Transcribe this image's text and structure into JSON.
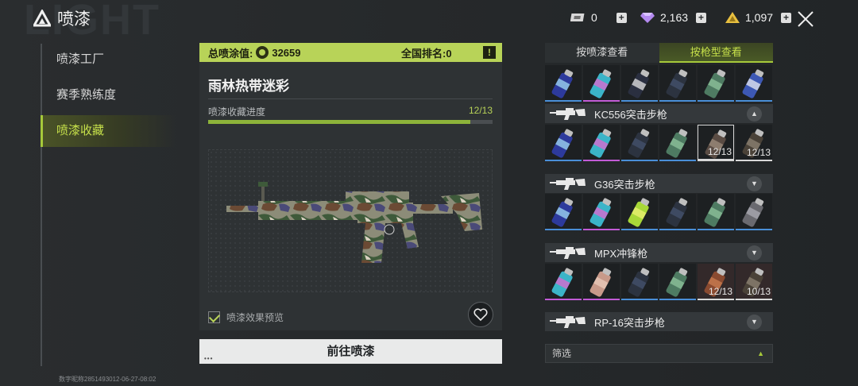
{
  "header": {
    "title": "喷漆",
    "watermark": "LIGHT",
    "currencies": [
      {
        "icon": "ticket-icon",
        "value": "0"
      },
      {
        "icon": "diamond-icon",
        "value": "2,163"
      },
      {
        "icon": "triangle-coin-icon",
        "value": "1,097"
      }
    ],
    "plus": "+"
  },
  "nav": {
    "items": [
      {
        "label": "喷漆工厂",
        "active": false
      },
      {
        "label": "赛季熟练度",
        "active": false
      },
      {
        "label": "喷漆收藏",
        "active": true
      }
    ]
  },
  "footer": {
    "id_text": "数字昵称2851493012-06-27-08:02"
  },
  "card": {
    "score_label": "总喷涂值:",
    "score_value": "32659",
    "rank_label": "全国排名:0",
    "info": "!",
    "skin_name": "雨林热带迷彩",
    "progress_label": "喷漆收藏进度",
    "progress_text": "12/13",
    "progress_fraction": 0.923,
    "preview_label": "喷漆效果预览",
    "goto_label": "前往喷漆",
    "goto_dots": "•••"
  },
  "right": {
    "tabs": [
      {
        "label": "按喷漆查看",
        "active": false
      },
      {
        "label": "按枪型查看",
        "active": true
      }
    ],
    "guns": [
      {
        "name": "KC556突击步枪",
        "expanded": true
      },
      {
        "name": "G36突击步枪",
        "expanded": false
      },
      {
        "name": "MPX冲锋枪",
        "expanded": false
      },
      {
        "name": "RP-16突击步枪",
        "expanded": false
      }
    ],
    "can_rows": [
      [
        {
          "color": "#2d3a9c",
          "accent": "#9bd2f0",
          "rarity": "#4a8fd8",
          "count": ""
        },
        {
          "color": "#3bb4c8",
          "accent": "#d86ad0",
          "rarity": "#c25bd6",
          "count": ""
        },
        {
          "color": "#2a2f40",
          "accent": "#d8d8d8",
          "rarity": "#4a8fd8",
          "count": ""
        },
        {
          "color": "#2c3340",
          "accent": "#44506a",
          "rarity": "#4a8fd8",
          "count": ""
        },
        {
          "color": "#4e7b62",
          "accent": "#8cc09a",
          "rarity": "#4a8fd8",
          "count": ""
        },
        {
          "color": "#3d58b4",
          "accent": "#e0e4f0",
          "rarity": "#4a8fd8",
          "count": ""
        }
      ],
      [
        {
          "color": "#2d3a9c",
          "accent": "#9bd2f0",
          "rarity": "#4a8fd8",
          "count": ""
        },
        {
          "color": "#3bb4c8",
          "accent": "#d86ad0",
          "rarity": "#c25bd6",
          "count": ""
        },
        {
          "color": "#2c3340",
          "accent": "#44506a",
          "rarity": "#4a8fd8",
          "count": ""
        },
        {
          "color": "#4e7b62",
          "accent": "#8cc09a",
          "rarity": "#4a8fd8",
          "count": ""
        },
        {
          "color": "#5a4c44",
          "accent": "#9a8a7a",
          "rarity": "#d8d8d8",
          "count": "12/13",
          "selected": true
        },
        {
          "color": "#4a4238",
          "accent": "#8a8070",
          "rarity": "#d8d8d8",
          "count": "12/13"
        }
      ],
      [
        {
          "color": "#2d3a9c",
          "accent": "#9bd2f0",
          "rarity": "#4a8fd8",
          "count": ""
        },
        {
          "color": "#3bb4c8",
          "accent": "#d86ad0",
          "rarity": "#c25bd6",
          "count": ""
        },
        {
          "color": "#a8d838",
          "accent": "#e8f070",
          "rarity": "#4a8fd8",
          "count": ""
        },
        {
          "color": "#2c3340",
          "accent": "#44506a",
          "rarity": "#4a8fd8",
          "count": ""
        },
        {
          "color": "#4e7b62",
          "accent": "#8cc09a",
          "rarity": "#4a8fd8",
          "count": ""
        },
        {
          "color": "#6a6a70",
          "accent": "#a8a8b0",
          "rarity": "#4a8fd8",
          "count": ""
        }
      ],
      [
        {
          "color": "#3bb4c8",
          "accent": "#d86ad0",
          "rarity": "#c25bd6",
          "count": ""
        },
        {
          "color": "#c89a8a",
          "accent": "#e8c8b8",
          "rarity": "#c25bd6",
          "count": ""
        },
        {
          "color": "#2c3340",
          "accent": "#44506a",
          "rarity": "#4a8fd8",
          "count": ""
        },
        {
          "color": "#4e7b62",
          "accent": "#8cc09a",
          "rarity": "#4a8fd8",
          "count": ""
        },
        {
          "color": "#8a4a30",
          "accent": "#c87a50",
          "rarity": "#d8d8d8",
          "count": "12/13",
          "dim": true
        },
        {
          "color": "#4a4238",
          "accent": "#8a8070",
          "rarity": "#d8d8d8",
          "count": "10/13",
          "dim": true
        }
      ]
    ],
    "filter_label": "筛选",
    "filter_arrow": "▲"
  }
}
